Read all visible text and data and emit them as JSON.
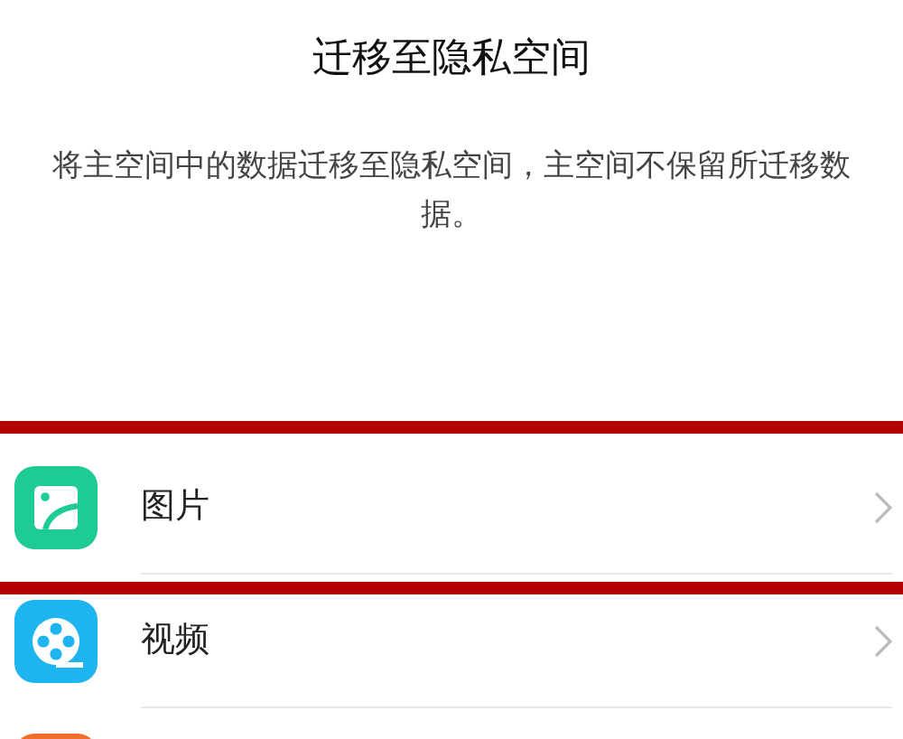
{
  "title": "迁移至隐私空间",
  "description": "将主空间中的数据迁移至隐私空间，主空间不保留所迁移数据。",
  "items": [
    {
      "kind": "picture",
      "label": "图片",
      "highlighted": true
    },
    {
      "kind": "video",
      "label": "视频",
      "highlighted": false
    },
    {
      "kind": "other",
      "highlighted": false
    }
  ]
}
